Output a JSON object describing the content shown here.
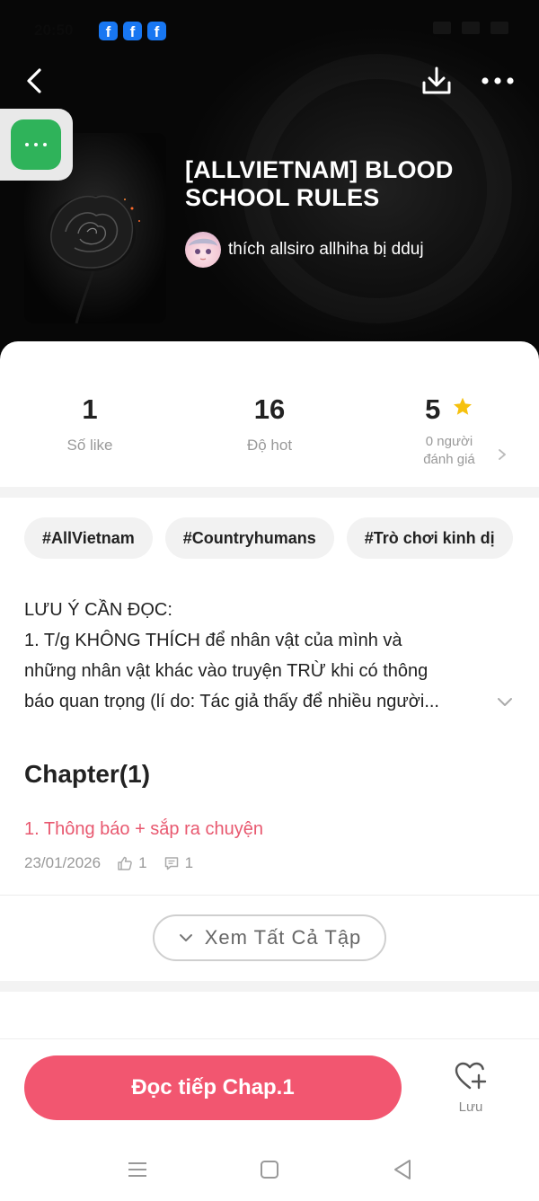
{
  "status_bar": {
    "time": "20:50",
    "notifications": [
      "facebook-icon",
      "facebook-icon",
      "facebook-icon"
    ]
  },
  "header": {
    "back_icon": "back-arrow-icon",
    "download_icon": "download-icon",
    "more_icon": "more-horizontal-icon"
  },
  "book": {
    "title": "[ALLVIETNAM] BLOOD SCHOOL RULES",
    "author": "thích allsiro allhiha bị dduj",
    "cover_icon": "black-rose-image"
  },
  "stats": {
    "likes": {
      "value": "1",
      "label": "Số like"
    },
    "hot": {
      "value": "16",
      "label": "Độ hot"
    },
    "rating": {
      "value": "5",
      "label_line1": "0 người",
      "label_line2": "đánh giá",
      "star_color": "#f6c10e"
    }
  },
  "tags": [
    "#AllVietnam",
    "#Countryhumans",
    "#Trò chơi kinh dị"
  ],
  "description": {
    "lines": [
      "LƯU Ý CẦN ĐỌC:",
      "1. T/g KHÔNG THÍCH để nhân vật của mình và",
      "những nhân vật khác vào truyện TRỪ khi có thông",
      "báo quan trọng (lí do: Tác giả thấy để nhiều người..."
    ]
  },
  "chapters": {
    "heading": "Chapter(1)",
    "items": [
      {
        "title": "1. Thông báo + sắp ra chuyện",
        "date": "23/01/2026",
        "likes": "1",
        "comments": "1"
      }
    ],
    "view_all_label": "Xem Tất Cả Tập"
  },
  "bottom_bar": {
    "read_label": "Đọc tiếp Chap.1",
    "save_label": "Lưu"
  },
  "colors": {
    "accent": "#f25670",
    "chapter_title": "#e8586f",
    "floating_menu": "#2fb35a",
    "facebook": "#1877f2"
  }
}
